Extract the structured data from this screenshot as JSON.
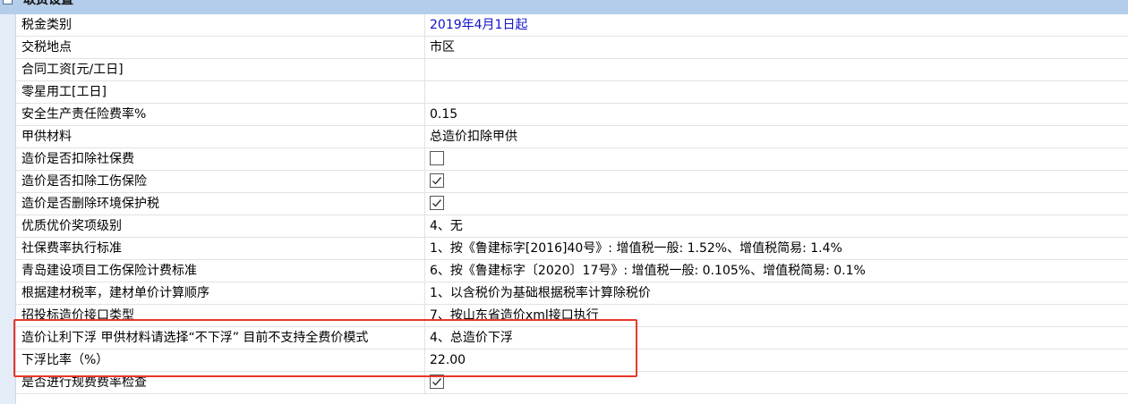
{
  "section": {
    "title": "取费设置"
  },
  "rows": [
    {
      "name": "税金类别",
      "value": "2019年4月1日起",
      "type": "link"
    },
    {
      "name": "交税地点",
      "value": "市区",
      "type": "text"
    },
    {
      "name": "合同工资[元/工日]",
      "value": "",
      "type": "text"
    },
    {
      "name": "零星用工[工日]",
      "value": "",
      "type": "text"
    },
    {
      "name": "安全生产责任险费率%",
      "value": "0.15",
      "type": "text"
    },
    {
      "name": "甲供材料",
      "value": "总造价扣除甲供",
      "type": "text"
    },
    {
      "name": "造价是否扣除社保费",
      "checked": false,
      "type": "checkbox"
    },
    {
      "name": "造价是否扣除工伤保险",
      "checked": true,
      "type": "checkbox"
    },
    {
      "name": "造价是否删除环境保护税",
      "checked": true,
      "type": "checkbox"
    },
    {
      "name": "优质优价奖项级别",
      "value": "4、无",
      "type": "text"
    },
    {
      "name": "社保费率执行标准",
      "value": "1、按《鲁建标字[2016]40号》: 增值税一般: 1.52%、增值税简易: 1.4%",
      "type": "text"
    },
    {
      "name": "青岛建设项目工伤保险计费标准",
      "value": "6、按《鲁建标字〔2020〕17号》: 增值税一般: 0.105%、增值税简易: 0.1%",
      "type": "text"
    },
    {
      "name": "根据建材税率，建材单价计算顺序",
      "value": "1、以含税价为基础根据税率计算除税价",
      "type": "text"
    },
    {
      "name": "招投标造价接口类型",
      "value": "7、按山东省造价xml接口执行",
      "type": "text"
    },
    {
      "name": "造价让利下浮   甲供材料请选择“不下浮” 目前不支持全费价模式",
      "value": "4、总造价下浮",
      "type": "text"
    },
    {
      "name": "下浮比率（%）",
      "value": "22.00",
      "type": "text"
    },
    {
      "name": "是否进行规费费率检查",
      "checked": true,
      "type": "checkbox"
    }
  ]
}
